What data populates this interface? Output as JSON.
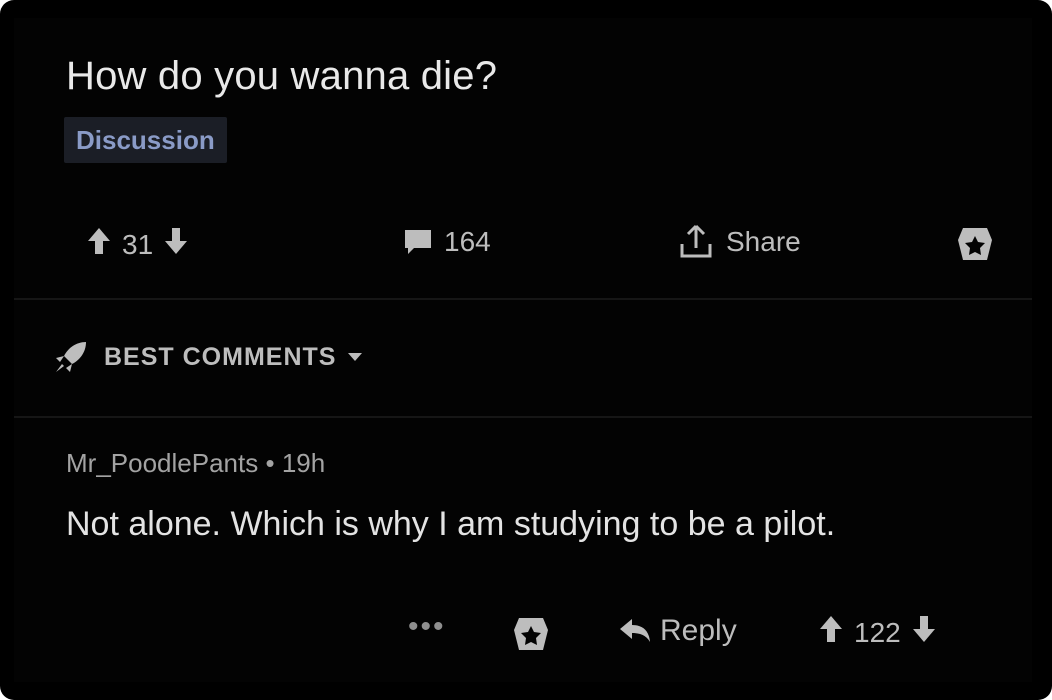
{
  "post": {
    "title": "How do you wanna die?",
    "flair": "Discussion",
    "score": "31",
    "comment_count": "164",
    "share_label": "Share"
  },
  "sort": {
    "label": "BEST COMMENTS"
  },
  "comment": {
    "author": "Mr_PoodlePants",
    "separator": "•",
    "age": "19h",
    "body": "Not alone.  Which is why I am studying to be a pilot.",
    "more_label": "•••",
    "reply_label": "Reply",
    "score": "122"
  },
  "colors": {
    "background": "#030303",
    "text": "#e9e9e9",
    "muted": "#a3a3a3",
    "flair_bg": "#1b1e26",
    "flair_text": "#8a9bc7"
  },
  "icons": [
    "arrow-up-icon",
    "arrow-down-icon",
    "comment-icon",
    "share-icon",
    "award-icon",
    "rocket-icon",
    "caret-down-icon",
    "reply-icon"
  ]
}
